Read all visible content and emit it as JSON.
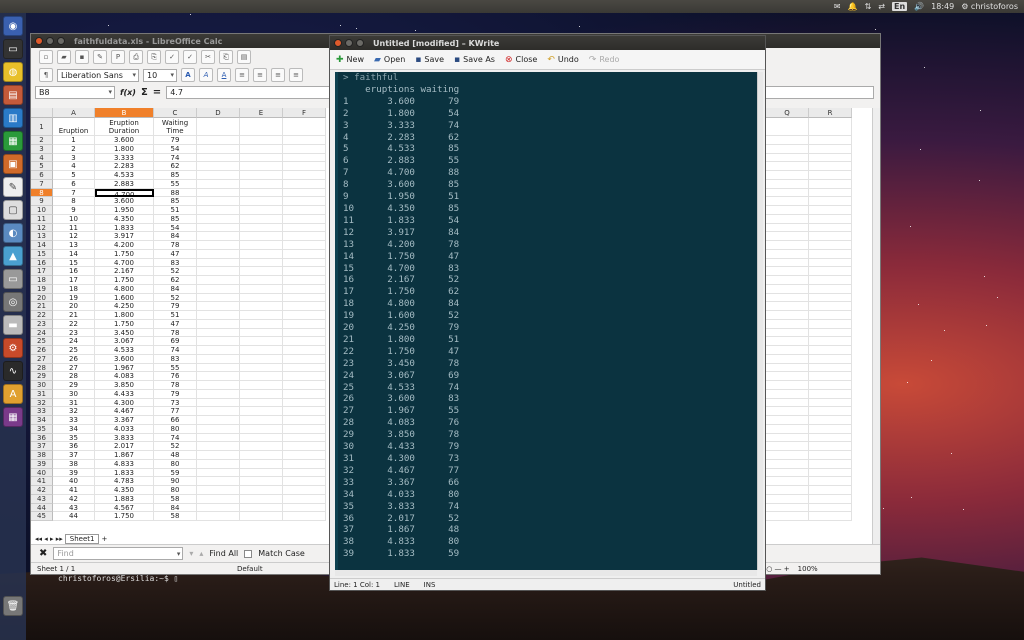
{
  "top_panel": {
    "keyboard": "En",
    "volume_icon": "volume-icon",
    "time": "18:49",
    "user": "christoforos"
  },
  "launcher": {
    "items": [
      "dash-icon",
      "terminal-icon",
      "chrome-icon",
      "files-icon",
      "writer-icon",
      "calc-icon",
      "impress-icon",
      "text-editor-icon",
      "document-viewer-icon",
      "image-viewer-icon",
      "r-studio-icon",
      "system-settings-icon",
      "disk-icon",
      "drive-icon",
      "settings-gear-icon",
      "system-monitor-icon",
      "software-icon",
      "workspaces-icon",
      "trash-icon"
    ]
  },
  "calc": {
    "title": "faithfuldata.xls - LibreOffice Calc",
    "font_name": "Liberation Sans",
    "font_size": "10",
    "name_box": "B8",
    "formula_value": "4.7",
    "func_icons": [
      "f(x)",
      "Σ",
      "="
    ],
    "columns": [
      "A",
      "B",
      "C",
      "D",
      "E",
      "F",
      "Q",
      "R"
    ],
    "headers": {
      "a": "Eruption",
      "b": "Eruption Duration",
      "c": "Waiting Time"
    },
    "rows": [
      [
        "1",
        "3.600",
        "79"
      ],
      [
        "2",
        "1.800",
        "54"
      ],
      [
        "3",
        "3.333",
        "74"
      ],
      [
        "4",
        "2.283",
        "62"
      ],
      [
        "5",
        "4.533",
        "85"
      ],
      [
        "6",
        "2.883",
        "55"
      ],
      [
        "7",
        "4.700",
        "88"
      ],
      [
        "8",
        "3.600",
        "85"
      ],
      [
        "9",
        "1.950",
        "51"
      ],
      [
        "10",
        "4.350",
        "85"
      ],
      [
        "11",
        "1.833",
        "54"
      ],
      [
        "12",
        "3.917",
        "84"
      ],
      [
        "13",
        "4.200",
        "78"
      ],
      [
        "14",
        "1.750",
        "47"
      ],
      [
        "15",
        "4.700",
        "83"
      ],
      [
        "16",
        "2.167",
        "52"
      ],
      [
        "17",
        "1.750",
        "62"
      ],
      [
        "18",
        "4.800",
        "84"
      ],
      [
        "19",
        "1.600",
        "52"
      ],
      [
        "20",
        "4.250",
        "79"
      ],
      [
        "21",
        "1.800",
        "51"
      ],
      [
        "22",
        "1.750",
        "47"
      ],
      [
        "23",
        "3.450",
        "78"
      ],
      [
        "24",
        "3.067",
        "69"
      ],
      [
        "25",
        "4.533",
        "74"
      ],
      [
        "26",
        "3.600",
        "83"
      ],
      [
        "27",
        "1.967",
        "55"
      ],
      [
        "28",
        "4.083",
        "76"
      ],
      [
        "29",
        "3.850",
        "78"
      ],
      [
        "30",
        "4.433",
        "79"
      ],
      [
        "31",
        "4.300",
        "73"
      ],
      [
        "32",
        "4.467",
        "77"
      ],
      [
        "33",
        "3.367",
        "66"
      ],
      [
        "34",
        "4.033",
        "80"
      ],
      [
        "35",
        "3.833",
        "74"
      ],
      [
        "36",
        "2.017",
        "52"
      ],
      [
        "37",
        "1.867",
        "48"
      ],
      [
        "38",
        "4.833",
        "80"
      ],
      [
        "39",
        "1.833",
        "59"
      ],
      [
        "40",
        "4.783",
        "90"
      ],
      [
        "41",
        "4.350",
        "80"
      ],
      [
        "42",
        "1.883",
        "58"
      ],
      [
        "43",
        "4.567",
        "84"
      ],
      [
        "44",
        "1.750",
        "58"
      ]
    ],
    "row_numbers_first": 1,
    "sheet_tab": "Sheet1",
    "find_placeholder": "Find",
    "find_all": "Find All",
    "match_case": "Match Case",
    "status_sheet": "Sheet 1 / 1",
    "status_style": "Default",
    "zoom": "100%"
  },
  "terminal": {
    "prompt": "christoforos@Ersilia:~$ "
  },
  "kwrite": {
    "title": "Untitled [modified] – KWrite",
    "toolbar": {
      "new": "New",
      "open": "Open",
      "save": "Save",
      "save_as": "Save As",
      "close": "Close",
      "undo": "Undo",
      "redo": "Redo"
    },
    "lines": [
      "> faithful",
      "    eruptions waiting",
      "1       3.600      79",
      "2       1.800      54",
      "3       3.333      74",
      "4       2.283      62",
      "5       4.533      85",
      "6       2.883      55",
      "7       4.700      88",
      "8       3.600      85",
      "9       1.950      51",
      "10      4.350      85",
      "11      1.833      54",
      "12      3.917      84",
      "13      4.200      78",
      "14      1.750      47",
      "15      4.700      83",
      "16      2.167      52",
      "17      1.750      62",
      "18      4.800      84",
      "19      1.600      52",
      "20      4.250      79",
      "21      1.800      51",
      "22      1.750      47",
      "23      3.450      78",
      "24      3.067      69",
      "25      4.533      74",
      "26      3.600      83",
      "27      1.967      55",
      "28      4.083      76",
      "29      3.850      78",
      "30      4.433      79",
      "31      4.300      73",
      "32      4.467      77",
      "33      3.367      66",
      "34      4.033      80",
      "35      3.833      74",
      "36      2.017      52",
      "37      1.867      48",
      "38      4.833      80",
      "39      1.833      59"
    ],
    "status": {
      "position": "Line: 1 Col: 1",
      "mode": "LINE",
      "ins": "INS",
      "doc": "Untitled"
    }
  }
}
